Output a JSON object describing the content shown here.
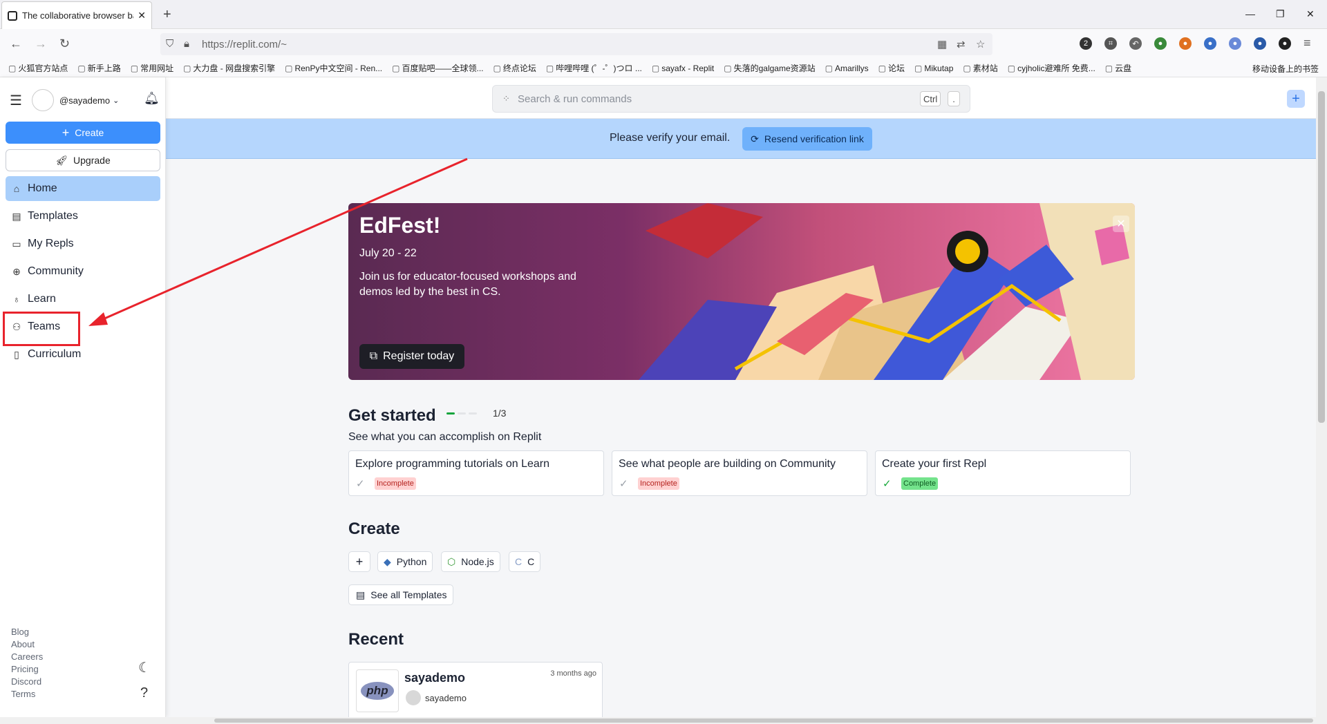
{
  "browser": {
    "tab_title": "The collaborative browser ba",
    "url": "https://replit.com/~",
    "bookmarks": [
      "火狐官方站点",
      "新手上路",
      "常用网址",
      "大力盘 - 网盘搜索引擎",
      "RenPy中文空间 - Ren...",
      "百度贴吧——全球领...",
      "终点论坛",
      "哔哩哔哩 (゜-゜)つロ ...",
      "sayafx - Replit",
      "失落的galgame资源站",
      "Amarillys",
      "论坛",
      "Mikutap",
      "素材站",
      "cyjholic避难所 免费...",
      "云盘"
    ],
    "bookmarks_right": "移动设备上的书签"
  },
  "sidebar": {
    "username": "@sayademo",
    "create_label": "Create",
    "upgrade_label": "Upgrade",
    "nav": [
      {
        "label": "Home",
        "icon": "home-icon"
      },
      {
        "label": "Templates",
        "icon": "file-icon"
      },
      {
        "label": "My Repls",
        "icon": "folder-icon"
      },
      {
        "label": "Community",
        "icon": "globe-icon"
      },
      {
        "label": "Learn",
        "icon": "learn-icon"
      },
      {
        "label": "Teams",
        "icon": "people-icon"
      },
      {
        "label": "Curriculum",
        "icon": "book-icon"
      }
    ],
    "footer": [
      "Blog",
      "About",
      "Careers",
      "Pricing",
      "Discord",
      "Terms"
    ]
  },
  "topbar": {
    "search_placeholder": "Search & run commands",
    "kbd1": "Ctrl",
    "kbd2": "."
  },
  "banner": {
    "text": "Please verify your email.",
    "button": "Resend verification link"
  },
  "hero": {
    "title": "EdFest!",
    "date": "July 20 - 22",
    "description": "Join us for educator-focused workshops and demos led by the best in CS.",
    "button": "Register today"
  },
  "get_started": {
    "title": "Get started",
    "progress_text": "1/3",
    "progress_fraction": 0.333,
    "subtitle": "See what you can accomplish on Replit",
    "cards": [
      {
        "title": "Explore programming tutorials on Learn",
        "status": "Incomplete"
      },
      {
        "title": "See what people are building on Community",
        "status": "Incomplete"
      },
      {
        "title": "Create your first Repl",
        "status": "Complete"
      }
    ]
  },
  "create": {
    "title": "Create",
    "chips": [
      "Python",
      "Node.js",
      "C"
    ],
    "see_all": "See all Templates"
  },
  "recent": {
    "title": "Recent",
    "repl_name": "sayademo",
    "time": "3 months ago",
    "owner": "sayademo",
    "logo_text": "php"
  },
  "colors": {
    "accent": "#3c8ffc",
    "banner": "#b5d6fd",
    "highlight": "#e8232c"
  }
}
